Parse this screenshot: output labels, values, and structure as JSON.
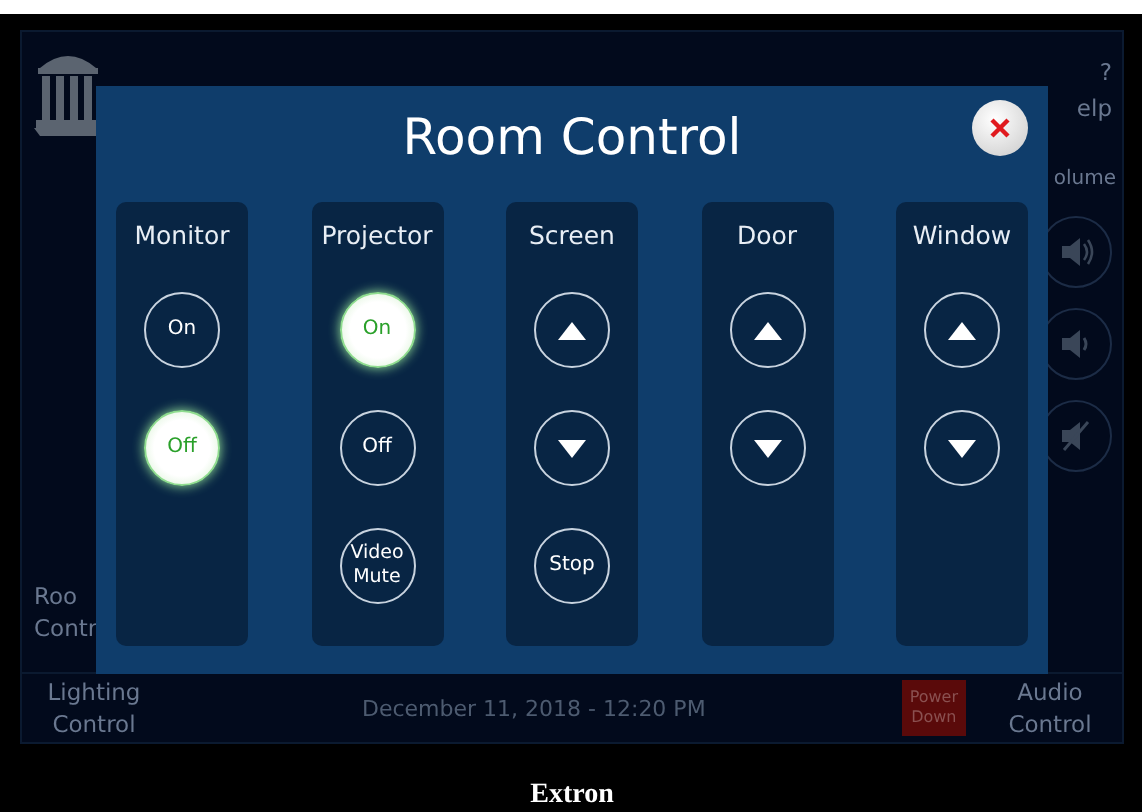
{
  "sidebar": {
    "room_control_lines": [
      "Roo",
      "Contr"
    ]
  },
  "help": {
    "glyph": "?",
    "label": "elp"
  },
  "volume": {
    "label": "olume",
    "icons": [
      {
        "kind": "loud"
      },
      {
        "kind": "soft"
      },
      {
        "kind": "mute"
      }
    ]
  },
  "bottom_bar": {
    "lighting_control_lines": [
      "Lighting",
      "Control"
    ],
    "datetime": "December 11, 2018 - 12:20 PM",
    "power_down_lines": [
      "Power",
      "Down"
    ],
    "audio_control_lines": [
      "Audio",
      "Control"
    ]
  },
  "dialog": {
    "title": "Room Control",
    "columns": [
      {
        "title": "Monitor",
        "buttons": [
          {
            "kind": "text",
            "label": "On",
            "selected": false
          },
          {
            "kind": "text",
            "label": "Off",
            "selected": true
          }
        ]
      },
      {
        "title": "Projector",
        "buttons": [
          {
            "kind": "text",
            "label": "On",
            "selected": true
          },
          {
            "kind": "text",
            "label": "Off",
            "selected": false
          },
          {
            "kind": "text",
            "label": "Video Mute",
            "selected": false
          }
        ]
      },
      {
        "title": "Screen",
        "buttons": [
          {
            "kind": "up",
            "selected": false
          },
          {
            "kind": "down",
            "selected": false
          },
          {
            "kind": "text",
            "label": "Stop",
            "selected": false
          }
        ]
      },
      {
        "title": "Door",
        "buttons": [
          {
            "kind": "up",
            "selected": false
          },
          {
            "kind": "down",
            "selected": false
          }
        ]
      },
      {
        "title": "Window",
        "buttons": [
          {
            "kind": "up",
            "selected": false
          },
          {
            "kind": "down",
            "selected": false
          }
        ]
      }
    ]
  },
  "caption": "Extron"
}
